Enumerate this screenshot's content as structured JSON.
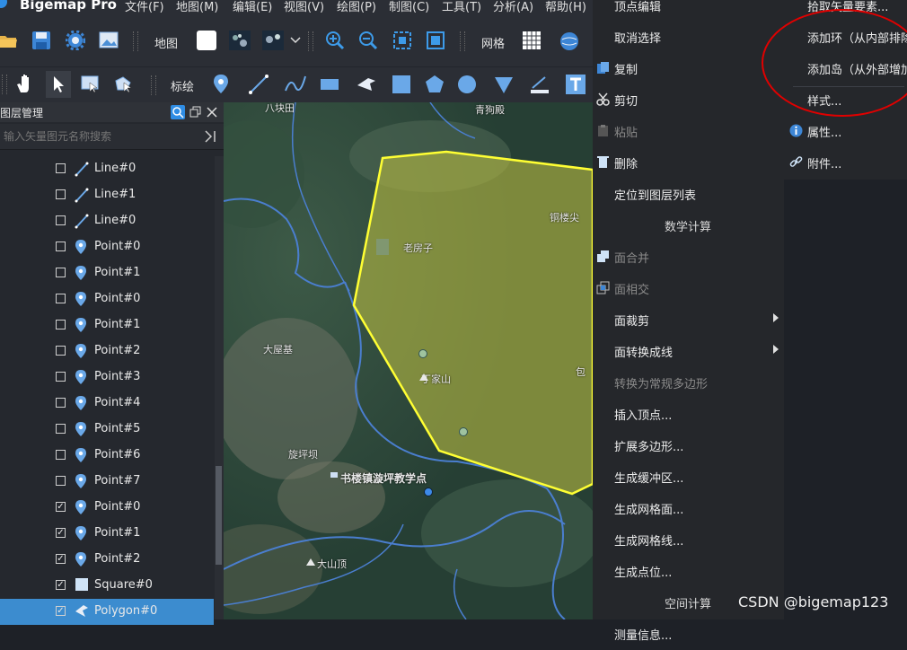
{
  "app": {
    "name": "Bigemap Pro"
  },
  "menubar": [
    "文件(F)",
    "地图(M)",
    "编辑(E)",
    "视图(V)",
    "绘图(P)",
    "制图(C)",
    "工具(T)",
    "分析(A)",
    "帮助(H)"
  ],
  "toolbar1": {
    "map_label": "地图",
    "grid_label": "网格"
  },
  "toolbar2": {
    "draw_label": "标绘"
  },
  "layer_panel": {
    "title": "图层管理",
    "search_placeholder": "输入矢量图元名称搜索",
    "items": [
      {
        "label": "Line#0",
        "type": "line",
        "checked": false
      },
      {
        "label": "Line#1",
        "type": "line",
        "checked": false
      },
      {
        "label": "Line#0",
        "type": "line",
        "checked": false
      },
      {
        "label": "Point#0",
        "type": "point",
        "checked": false
      },
      {
        "label": "Point#1",
        "type": "point",
        "checked": false
      },
      {
        "label": "Point#0",
        "type": "point",
        "checked": false
      },
      {
        "label": "Point#1",
        "type": "point",
        "checked": false
      },
      {
        "label": "Point#2",
        "type": "point",
        "checked": false
      },
      {
        "label": "Point#3",
        "type": "point",
        "checked": false
      },
      {
        "label": "Point#4",
        "type": "point",
        "checked": false
      },
      {
        "label": "Point#5",
        "type": "point",
        "checked": false
      },
      {
        "label": "Point#6",
        "type": "point",
        "checked": false
      },
      {
        "label": "Point#7",
        "type": "point",
        "checked": false
      },
      {
        "label": "Point#0",
        "type": "point",
        "checked": true
      },
      {
        "label": "Point#1",
        "type": "point",
        "checked": true
      },
      {
        "label": "Point#2",
        "type": "point",
        "checked": true
      },
      {
        "label": "Square#0",
        "type": "square",
        "checked": true
      },
      {
        "label": "Polygon#0",
        "type": "polygon",
        "checked": true,
        "selected": true
      }
    ]
  },
  "map": {
    "labels": [
      "八块田",
      "青狗殿",
      "老房子",
      "铜楼尖",
      "大屋基",
      "丁家山",
      "旋坪坝",
      "书楼镇漩坪教学点",
      "大山顶",
      "包"
    ],
    "polygon_color": "#ffff33"
  },
  "context_menu": {
    "items": [
      {
        "label": "顶点编辑"
      },
      {
        "label": "取消选择"
      },
      {
        "label": "复制",
        "icon": "copy-icon"
      },
      {
        "label": "剪切",
        "icon": "scissors-icon"
      },
      {
        "label": "粘贴",
        "icon": "paste-icon",
        "disabled": true
      },
      {
        "label": "删除",
        "icon": "trash-icon"
      },
      {
        "label": "定位到图层列表"
      },
      {
        "label": "数学计算",
        "header": true
      },
      {
        "label": "面合并",
        "icon": "merge-icon",
        "disabled": true
      },
      {
        "label": "面相交",
        "icon": "intersect-icon",
        "disabled": true
      },
      {
        "label": "面裁剪",
        "submenu": true
      },
      {
        "label": "面转换成线",
        "submenu": true
      },
      {
        "label": "转换为常规多边形",
        "disabled": true
      },
      {
        "label": "插入顶点..."
      },
      {
        "label": "扩展多边形..."
      },
      {
        "label": "生成缓冲区..."
      },
      {
        "label": "生成网格面..."
      },
      {
        "label": "生成网格线..."
      },
      {
        "label": "生成点位..."
      },
      {
        "label": "空间计算",
        "header": true
      },
      {
        "label": "测量信息..."
      }
    ]
  },
  "submenu": {
    "items": [
      {
        "label": "拾取矢量要素..."
      },
      {
        "label": "添加环（从内部排除）"
      },
      {
        "label": "添加岛（从外部增加）"
      },
      {
        "label": "样式..."
      },
      {
        "label": "属性...",
        "icon": "info-icon"
      },
      {
        "label": "附件...",
        "icon": "link-icon"
      }
    ]
  },
  "watermark": "CSDN @bigemap123"
}
